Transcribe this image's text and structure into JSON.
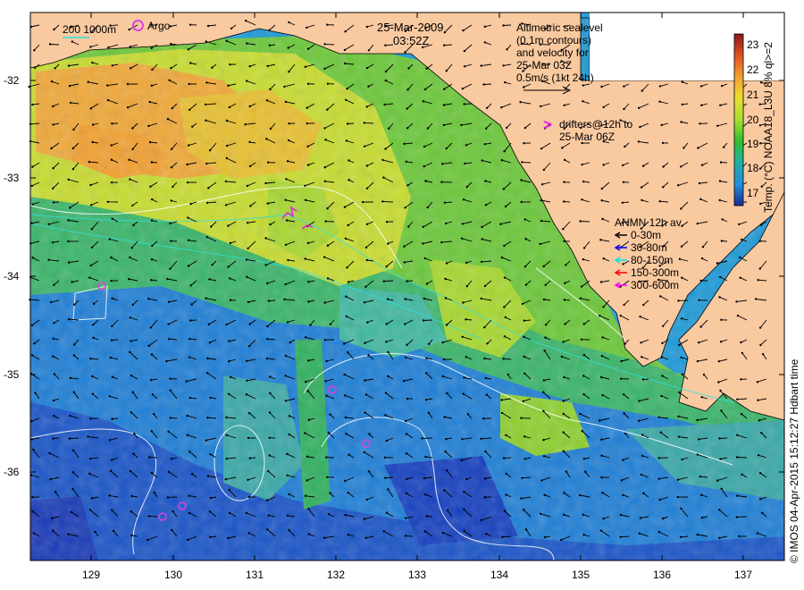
{
  "header": {
    "date": "25-Mar-2009",
    "time": "03:52Z"
  },
  "legend_top_left": {
    "depth_contours": "200  1000m",
    "argo_label": "Argo"
  },
  "altimetry_note": {
    "lines": [
      "Altimetric sealevel",
      "(0.1m contours)",
      "and velocity for",
      "25-Mar 03Z",
      "0.5m/s (1kt 24h)"
    ]
  },
  "drifters_note": {
    "symbol": ">",
    "lines": [
      "drifters@12h to",
      "25-Mar 06Z"
    ]
  },
  "anmn_legend": {
    "title": "ANMN 12h av.",
    "items": [
      {
        "label": "0-30m",
        "color": "#000000"
      },
      {
        "label": "30-80m",
        "color": "#0000ff"
      },
      {
        "label": "80-150m",
        "color": "#00e5e5"
      },
      {
        "label": "150-300m",
        "color": "#ff0000"
      },
      {
        "label": "300-600m",
        "color": "#ff00ff"
      }
    ]
  },
  "colorbar": {
    "title": "Temp. (°C) NOAA18_L3U 8% ql>=2",
    "ticks": [
      "23",
      "22",
      "21",
      "20",
      "19",
      "18",
      "17"
    ],
    "colors": [
      "#8b1a1a",
      "#e05020",
      "#f5a030",
      "#e8e030",
      "#a8e030",
      "#30c030",
      "#20b0a0",
      "#2090e0",
      "#1a2a90"
    ]
  },
  "credit": "© IMOS 04-Apr-2015 15:12:27 Hdbart time",
  "axes": {
    "x_ticks": [
      "129",
      "130",
      "131",
      "132",
      "133",
      "134",
      "135",
      "136",
      "137"
    ],
    "y_ticks": [
      "-32",
      "-33",
      "-34",
      "-35",
      "-36"
    ]
  },
  "colors": {
    "land": "#f9c9a0",
    "argo": "#e040e0",
    "drifter": "#e020e0"
  }
}
